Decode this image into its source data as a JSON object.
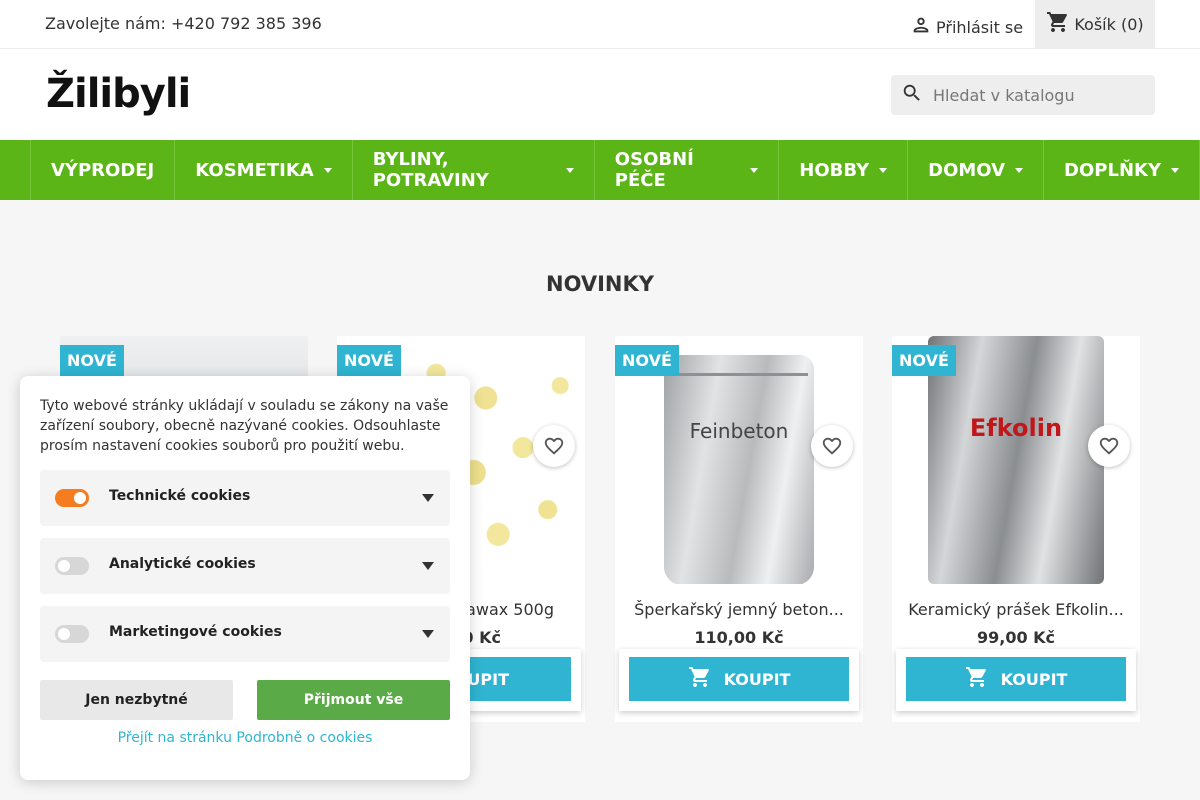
{
  "topbar": {
    "phone": "Zavolejte nám: +420 792 385 396",
    "login_label": "Přihlásit se",
    "login_icon": "person-icon",
    "cart_label": "Košík (0)",
    "cart_icon": "cart-icon"
  },
  "header": {
    "logo": "Žilibyli",
    "search": {
      "placeholder": "Hledat v katalogu",
      "icon": "search-icon"
    }
  },
  "nav": {
    "items": [
      {
        "label": "VÝPRODEJ",
        "dropdown": false
      },
      {
        "label": "KOSMETIKA",
        "dropdown": true
      },
      {
        "label": "BYLINY, POTRAVINY",
        "dropdown": true
      },
      {
        "label": "OSOBNÍ PÉČE",
        "dropdown": true
      },
      {
        "label": "HOBBY",
        "dropdown": true
      },
      {
        "label": "DOMOV",
        "dropdown": true
      },
      {
        "label": "DOPLŇKY",
        "dropdown": true
      }
    ]
  },
  "section_title": "NOVINKY",
  "products": [
    {
      "badge": "NOVÉ",
      "name": "",
      "price": "",
      "buy_label": ""
    },
    {
      "badge": "NOVÉ",
      "name": "rawax 500g",
      "price": "0 Kč",
      "buy_label": "KOUPIT"
    },
    {
      "badge": "NOVÉ",
      "name": "Šperkařský jemný beton...",
      "price": "110,00 Kč",
      "buy_label": "KOUPIT",
      "image_label": "Feinbeton"
    },
    {
      "badge": "NOVÉ",
      "name": "Keramický prášek Efkolin...",
      "price": "99,00 Kč",
      "buy_label": "KOUPIT",
      "image_label": "Efkolin"
    }
  ],
  "cookie": {
    "text": "Tyto webové stránky ukládají v souladu se zákony na vaše zařízení soubory, obecně nazývané cookies. Odsouhlaste prosím nastavení cookies souborů pro použití webu.",
    "options": [
      {
        "label": "Technické cookies",
        "enabled": true
      },
      {
        "label": "Analytické cookies",
        "enabled": false
      },
      {
        "label": "Marketingové cookies",
        "enabled": false
      }
    ],
    "btn_min": "Jen nezbytné",
    "btn_all": "Přijmout vše",
    "link": "Přejít na stránku Podrobně o cookies"
  },
  "colors": {
    "nav_green": "#5cb516",
    "accent_blue": "#2fb5d2",
    "toggle_orange": "#f57c1f",
    "accept_green": "#5aaa47"
  }
}
